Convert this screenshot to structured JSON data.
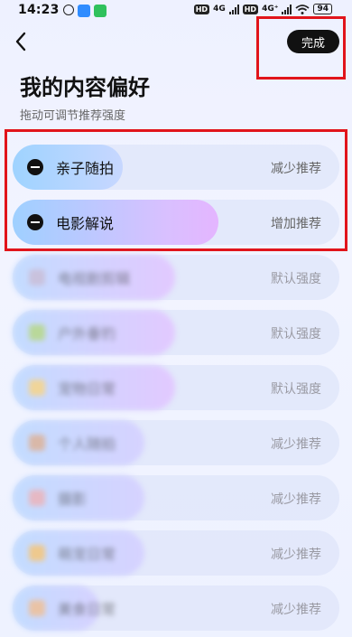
{
  "status_bar": {
    "time": "14:23",
    "net_4g_1": "4G",
    "net_4g_2": "4G⁺",
    "battery": "94",
    "icon_colors": {
      "app1": "#2f8cff",
      "app2": "#2fc15c"
    }
  },
  "header": {
    "back_icon": "chevron-left-icon",
    "done_label": "完成",
    "title": "我的内容偏好",
    "subtitle": "拖动可调节推荐强度"
  },
  "accent": {
    "highlight": "#e1141b",
    "done_bg": "#111111"
  },
  "preferences": [
    {
      "label": "亲子随拍",
      "status": "减少推荐",
      "visible": true,
      "gradient": [
        "#9fd3ff",
        "#c7d7ff"
      ]
    },
    {
      "label": "电影解说",
      "status": "增加推荐",
      "visible": true,
      "gradient": [
        "#9fd0ff",
        "#e4b5ff"
      ]
    },
    {
      "label": "电视剧剪辑",
      "status": "默认强度",
      "visible": false,
      "gradient": [
        "#c3dcff",
        "#e2c9ff"
      ]
    },
    {
      "label": "户外垂钓",
      "status": "默认强度",
      "visible": false,
      "gradient": [
        "#c3dcff",
        "#e2c9ff"
      ]
    },
    {
      "label": "宠物日常",
      "status": "默认强度",
      "visible": false,
      "gradient": [
        "#c3dcff",
        "#e2c9ff"
      ]
    },
    {
      "label": "个人随拍",
      "status": "减少推荐",
      "visible": false,
      "gradient": [
        "#c3dcff",
        "#d6d2ff"
      ]
    },
    {
      "label": "摄影",
      "status": "减少推荐",
      "visible": false,
      "gradient": [
        "#c3dcff",
        "#d6d2ff"
      ]
    },
    {
      "label": "萌宠日常",
      "status": "减少推荐",
      "visible": false,
      "gradient": [
        "#c3dcff",
        "#d6d2ff"
      ]
    },
    {
      "label": "美食日常",
      "status": "减少推荐",
      "visible": false,
      "gradient": [
        "#c3dcff",
        "#d6d2ff"
      ]
    }
  ]
}
